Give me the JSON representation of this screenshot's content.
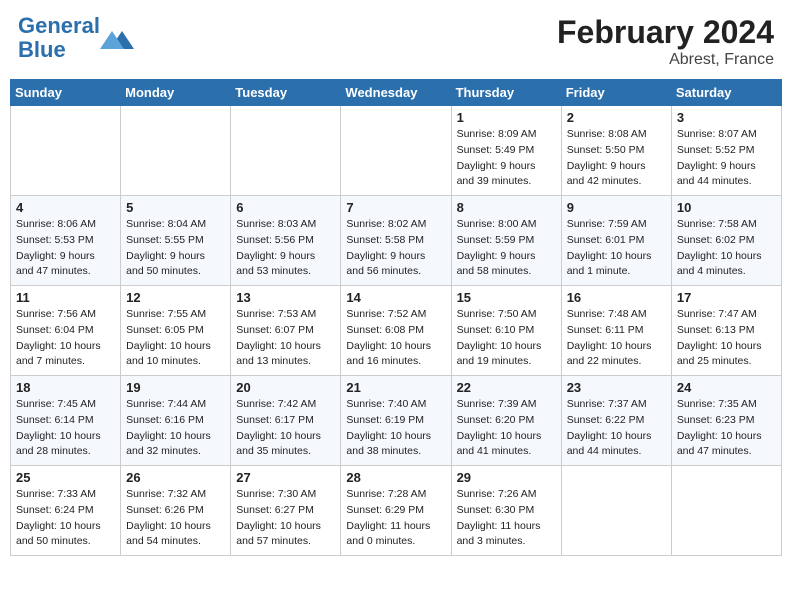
{
  "header": {
    "logo_line1": "General",
    "logo_line2": "Blue",
    "month_year": "February 2024",
    "location": "Abrest, France"
  },
  "weekdays": [
    "Sunday",
    "Monday",
    "Tuesday",
    "Wednesday",
    "Thursday",
    "Friday",
    "Saturday"
  ],
  "weeks": [
    [
      {
        "day": "",
        "info": ""
      },
      {
        "day": "",
        "info": ""
      },
      {
        "day": "",
        "info": ""
      },
      {
        "day": "",
        "info": ""
      },
      {
        "day": "1",
        "info": "Sunrise: 8:09 AM\nSunset: 5:49 PM\nDaylight: 9 hours\nand 39 minutes."
      },
      {
        "day": "2",
        "info": "Sunrise: 8:08 AM\nSunset: 5:50 PM\nDaylight: 9 hours\nand 42 minutes."
      },
      {
        "day": "3",
        "info": "Sunrise: 8:07 AM\nSunset: 5:52 PM\nDaylight: 9 hours\nand 44 minutes."
      }
    ],
    [
      {
        "day": "4",
        "info": "Sunrise: 8:06 AM\nSunset: 5:53 PM\nDaylight: 9 hours\nand 47 minutes."
      },
      {
        "day": "5",
        "info": "Sunrise: 8:04 AM\nSunset: 5:55 PM\nDaylight: 9 hours\nand 50 minutes."
      },
      {
        "day": "6",
        "info": "Sunrise: 8:03 AM\nSunset: 5:56 PM\nDaylight: 9 hours\nand 53 minutes."
      },
      {
        "day": "7",
        "info": "Sunrise: 8:02 AM\nSunset: 5:58 PM\nDaylight: 9 hours\nand 56 minutes."
      },
      {
        "day": "8",
        "info": "Sunrise: 8:00 AM\nSunset: 5:59 PM\nDaylight: 9 hours\nand 58 minutes."
      },
      {
        "day": "9",
        "info": "Sunrise: 7:59 AM\nSunset: 6:01 PM\nDaylight: 10 hours\nand 1 minute."
      },
      {
        "day": "10",
        "info": "Sunrise: 7:58 AM\nSunset: 6:02 PM\nDaylight: 10 hours\nand 4 minutes."
      }
    ],
    [
      {
        "day": "11",
        "info": "Sunrise: 7:56 AM\nSunset: 6:04 PM\nDaylight: 10 hours\nand 7 minutes."
      },
      {
        "day": "12",
        "info": "Sunrise: 7:55 AM\nSunset: 6:05 PM\nDaylight: 10 hours\nand 10 minutes."
      },
      {
        "day": "13",
        "info": "Sunrise: 7:53 AM\nSunset: 6:07 PM\nDaylight: 10 hours\nand 13 minutes."
      },
      {
        "day": "14",
        "info": "Sunrise: 7:52 AM\nSunset: 6:08 PM\nDaylight: 10 hours\nand 16 minutes."
      },
      {
        "day": "15",
        "info": "Sunrise: 7:50 AM\nSunset: 6:10 PM\nDaylight: 10 hours\nand 19 minutes."
      },
      {
        "day": "16",
        "info": "Sunrise: 7:48 AM\nSunset: 6:11 PM\nDaylight: 10 hours\nand 22 minutes."
      },
      {
        "day": "17",
        "info": "Sunrise: 7:47 AM\nSunset: 6:13 PM\nDaylight: 10 hours\nand 25 minutes."
      }
    ],
    [
      {
        "day": "18",
        "info": "Sunrise: 7:45 AM\nSunset: 6:14 PM\nDaylight: 10 hours\nand 28 minutes."
      },
      {
        "day": "19",
        "info": "Sunrise: 7:44 AM\nSunset: 6:16 PM\nDaylight: 10 hours\nand 32 minutes."
      },
      {
        "day": "20",
        "info": "Sunrise: 7:42 AM\nSunset: 6:17 PM\nDaylight: 10 hours\nand 35 minutes."
      },
      {
        "day": "21",
        "info": "Sunrise: 7:40 AM\nSunset: 6:19 PM\nDaylight: 10 hours\nand 38 minutes."
      },
      {
        "day": "22",
        "info": "Sunrise: 7:39 AM\nSunset: 6:20 PM\nDaylight: 10 hours\nand 41 minutes."
      },
      {
        "day": "23",
        "info": "Sunrise: 7:37 AM\nSunset: 6:22 PM\nDaylight: 10 hours\nand 44 minutes."
      },
      {
        "day": "24",
        "info": "Sunrise: 7:35 AM\nSunset: 6:23 PM\nDaylight: 10 hours\nand 47 minutes."
      }
    ],
    [
      {
        "day": "25",
        "info": "Sunrise: 7:33 AM\nSunset: 6:24 PM\nDaylight: 10 hours\nand 50 minutes."
      },
      {
        "day": "26",
        "info": "Sunrise: 7:32 AM\nSunset: 6:26 PM\nDaylight: 10 hours\nand 54 minutes."
      },
      {
        "day": "27",
        "info": "Sunrise: 7:30 AM\nSunset: 6:27 PM\nDaylight: 10 hours\nand 57 minutes."
      },
      {
        "day": "28",
        "info": "Sunrise: 7:28 AM\nSunset: 6:29 PM\nDaylight: 11 hours\nand 0 minutes."
      },
      {
        "day": "29",
        "info": "Sunrise: 7:26 AM\nSunset: 6:30 PM\nDaylight: 11 hours\nand 3 minutes."
      },
      {
        "day": "",
        "info": ""
      },
      {
        "day": "",
        "info": ""
      }
    ]
  ]
}
